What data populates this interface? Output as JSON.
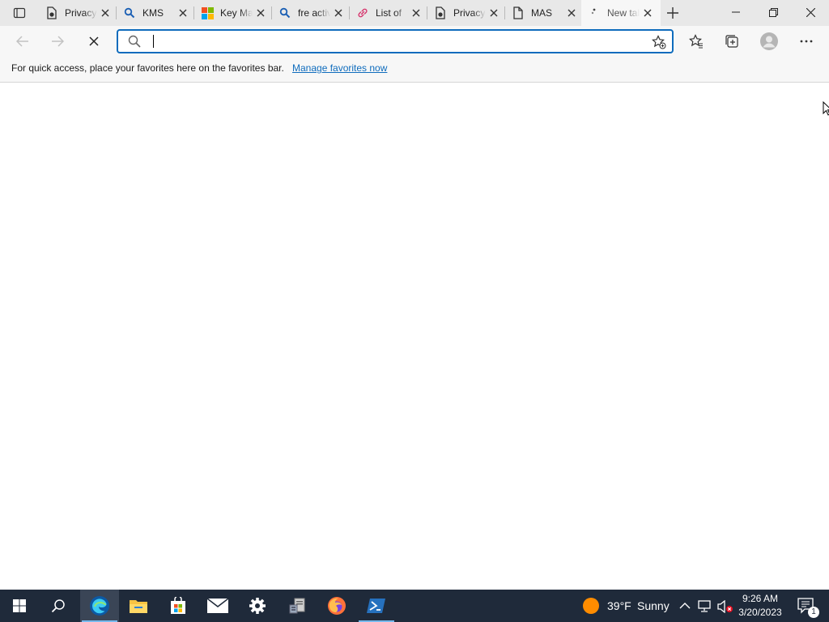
{
  "tabs": [
    {
      "title": "Privacy",
      "icon": "doc-lock-icon",
      "active": false
    },
    {
      "title": "KMS",
      "icon": "search-icon",
      "active": false
    },
    {
      "title": "Key Management",
      "icon": "microsoft-logo-icon",
      "active": false
    },
    {
      "title": "fre activation",
      "icon": "search-icon",
      "active": false
    },
    {
      "title": "List of",
      "icon": "link-icon",
      "active": false
    },
    {
      "title": "Privacy",
      "icon": "doc-lock-icon",
      "active": false
    },
    {
      "title": "MAS",
      "icon": "document-icon",
      "active": false
    },
    {
      "title": "New tab",
      "icon": "loading-icon",
      "active": true
    }
  ],
  "address_bar": {
    "value": "",
    "placeholder": ""
  },
  "favorites_bar": {
    "message": "For quick access, place your favorites here on the favorites bar.",
    "link": "Manage favorites now"
  },
  "taskbar": {
    "apps": [
      "start-icon",
      "search-icon",
      "edge-icon",
      "file-explorer-icon",
      "store-icon",
      "mail-icon",
      "settings-icon",
      "server-manager-icon",
      "firefox-icon",
      "powershell-icon"
    ],
    "active_app": "edge-icon",
    "weather": {
      "temp": "39°F",
      "condition": "Sunny"
    },
    "time": "9:26 AM",
    "date": "3/20/2023",
    "notification_count": "1"
  },
  "colors": {
    "accent": "#0f6cbd",
    "taskbar": "#1f2a3a",
    "tab_strip": "#e8e8e8"
  }
}
